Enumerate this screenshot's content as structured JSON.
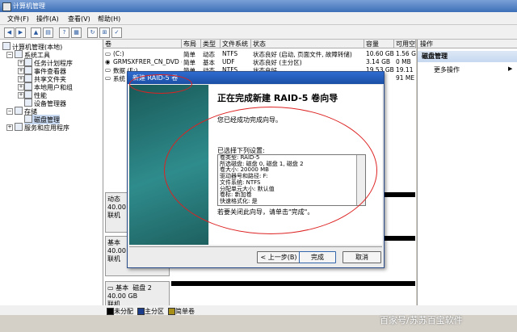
{
  "window": {
    "title": "计算机管理"
  },
  "menu": [
    "文件(F)",
    "操作(A)",
    "查看(V)",
    "帮助(H)"
  ],
  "tree": {
    "root": "计算机管理(本地)",
    "items": [
      "系统工具",
      "任务计划程序",
      "事件查看器",
      "共享文件夹",
      "本地用户和组",
      "性能",
      "设备管理器",
      "存储",
      "磁盘管理",
      "服务和应用程序"
    ]
  },
  "volume_table": {
    "headers": [
      "卷",
      "布局",
      "类型",
      "文件系统",
      "状态",
      "容量",
      "可用空"
    ],
    "rows": [
      [
        "(C:)",
        "简单",
        "动态",
        "NTFS",
        "状态良好 (启动, 页面文件, 故障转储)",
        "10.60 GB",
        "1.56 G"
      ],
      [
        "GRMSXFRER_CN_DVD (D:)",
        "简单",
        "基本",
        "UDF",
        "状态良好 (主分区)",
        "3.14 GB",
        "0 MB"
      ],
      [
        "数据 (E:)",
        "简单",
        "动态",
        "NTFS",
        "状态良好",
        "19.53 GB",
        "19.11"
      ],
      [
        "系统",
        "",
        "",
        "",
        "",
        "",
        "91 ME"
      ]
    ]
  },
  "disks": [
    {
      "name": "动态",
      "size": "40.00",
      "state": "联机"
    },
    {
      "name": "基本",
      "size": "40.00",
      "state": "联机"
    },
    {
      "name": "磁盘 2",
      "type": "基本",
      "size": "40.00 GB",
      "state": "联机"
    }
  ],
  "legend": [
    "未分配",
    "主分区",
    "简单卷"
  ],
  "actions": {
    "header": "操作",
    "section": "磁盘管理",
    "more": "更多操作"
  },
  "wizard": {
    "title": "新建 RAID-5 卷",
    "heading": "正在完成新建 RAID-5 卷向导",
    "done_text": "您已经成功完成向导。",
    "selected_label": "已选择下列设置:",
    "settings": [
      "卷类型: RAID-5",
      "所选磁盘: 磁盘 0, 磁盘 1, 磁盘 2",
      "卷大小: 20000 MB",
      "驱动器号和路径: F:",
      "文件系统: NTFS",
      "分配单元大小: 默认值",
      "卷标: 新加卷",
      "快速格式化: 是"
    ],
    "close_hint": "若要关闭此向导，请单击\"完成\"。",
    "back": "< 上一步(B)",
    "finish": "完成",
    "cancel": "取消"
  },
  "watermark": "百家号/苏苏百宝软件"
}
